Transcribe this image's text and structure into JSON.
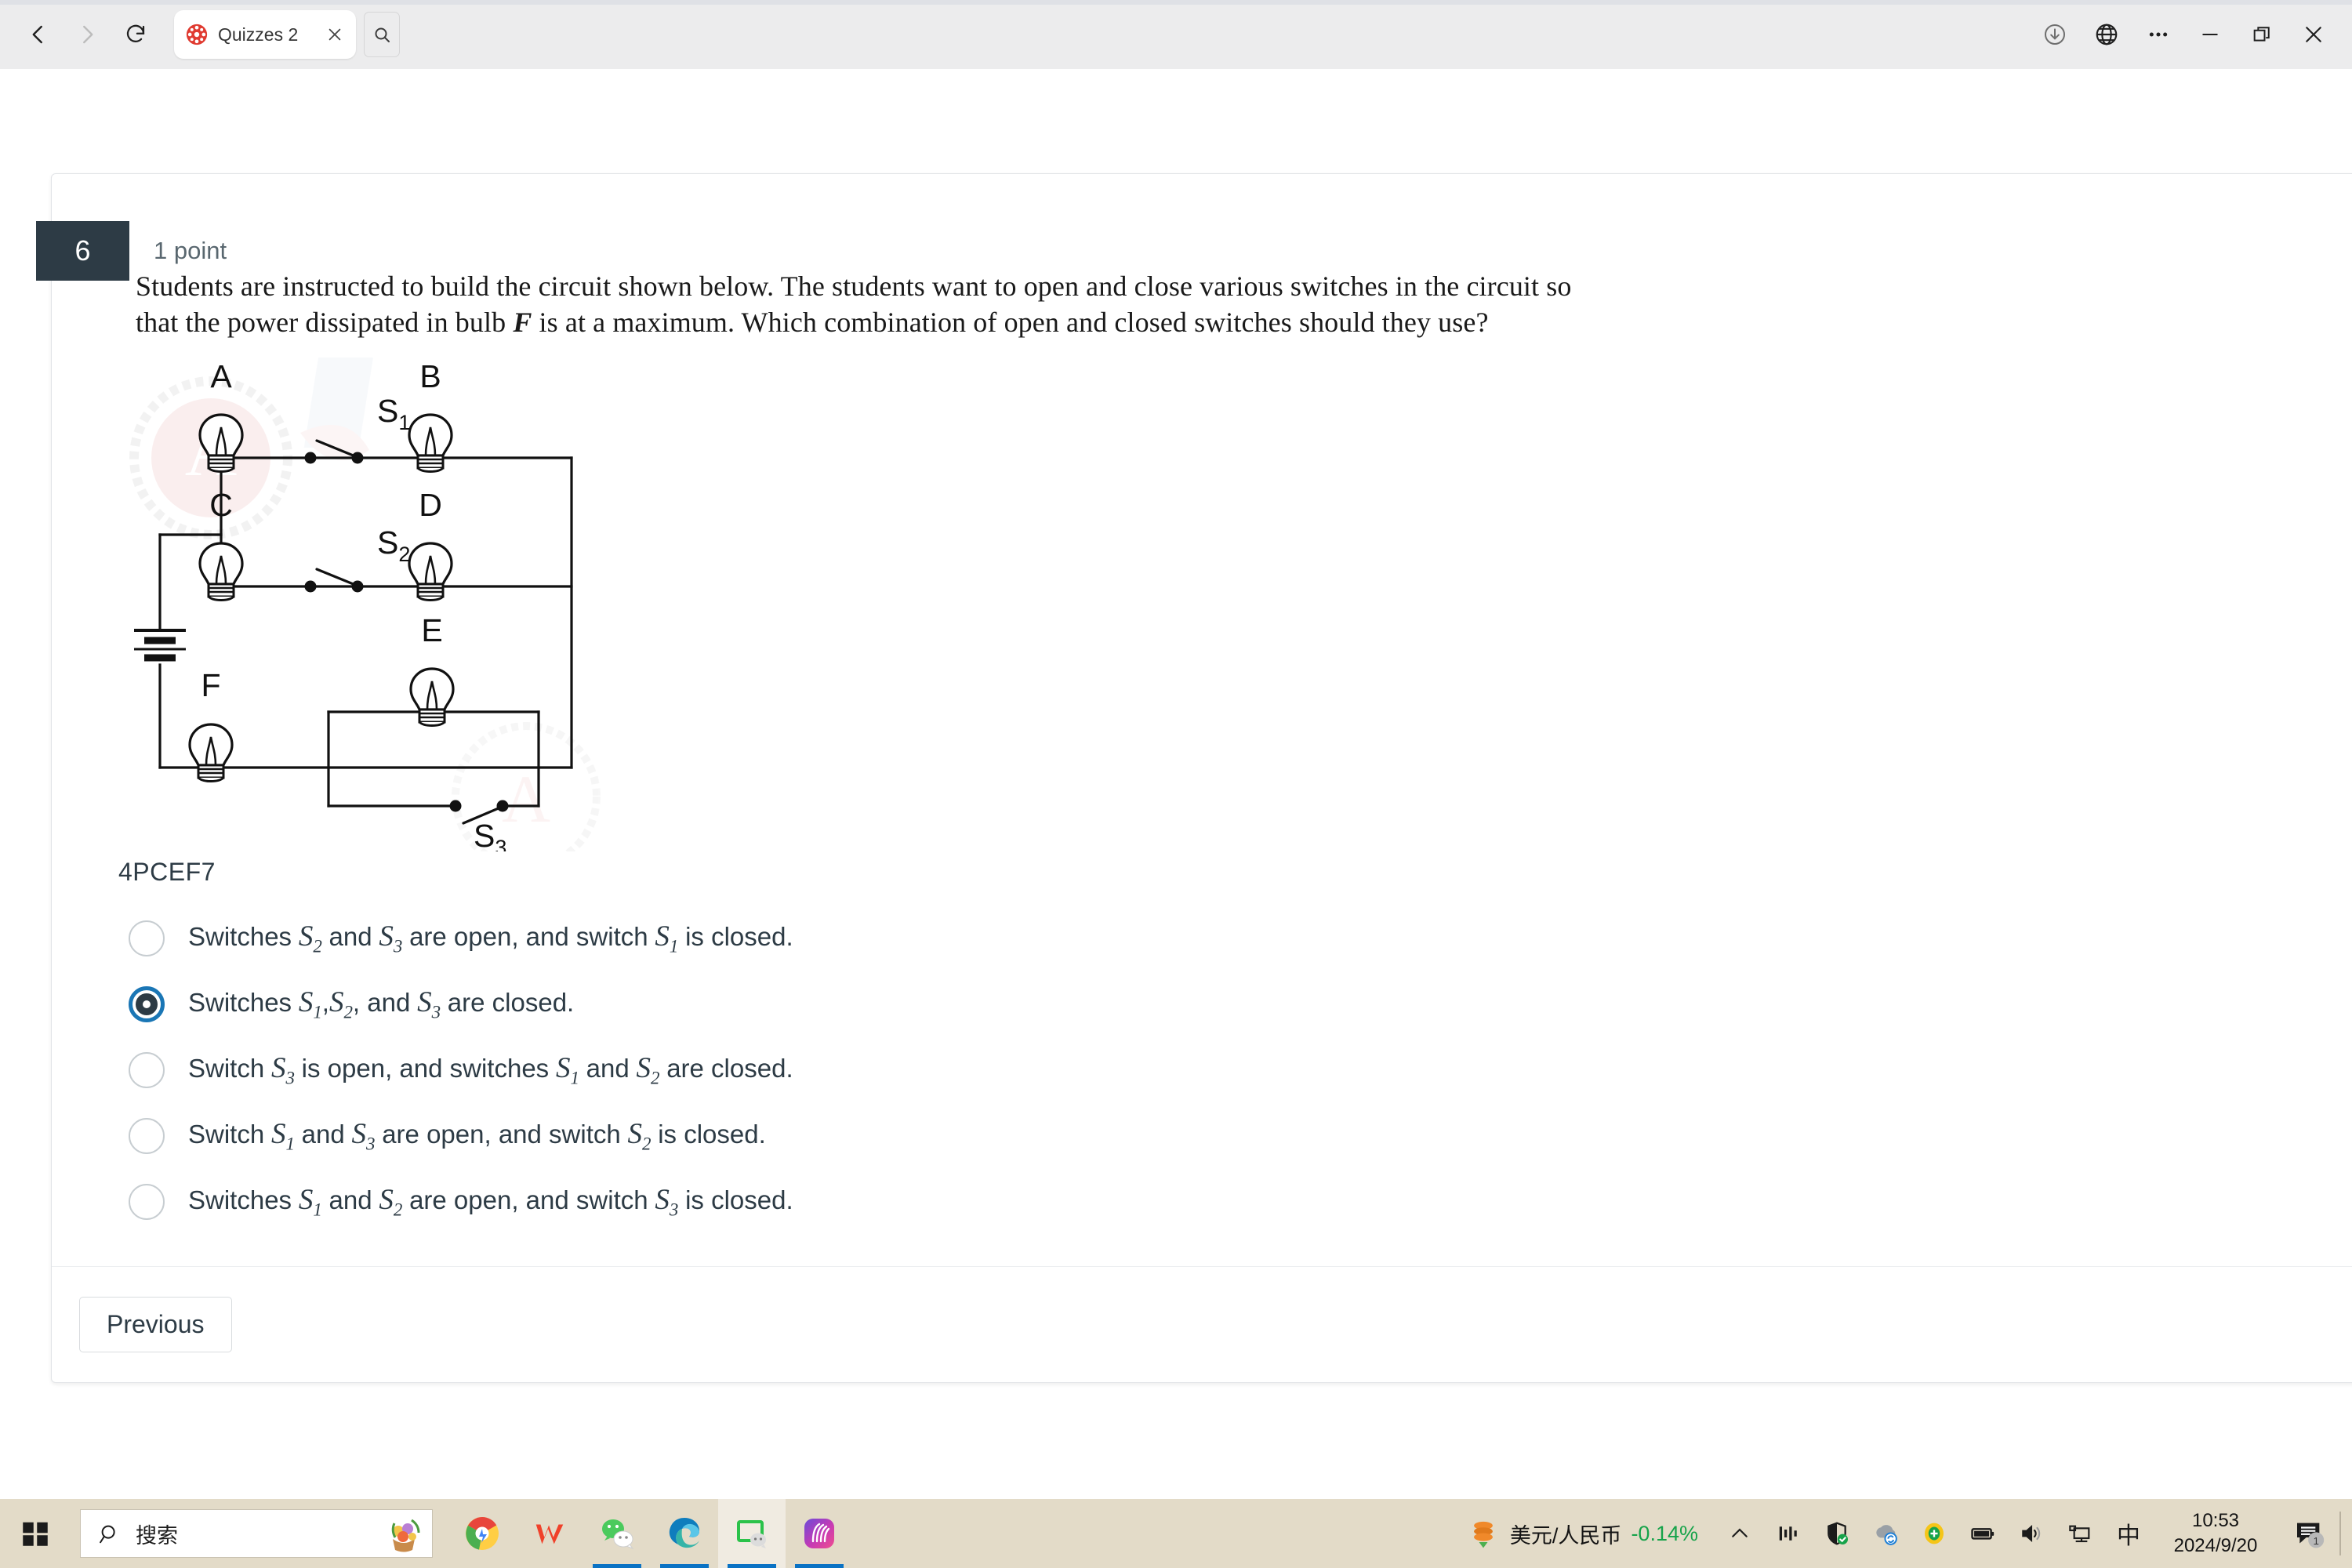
{
  "browser": {
    "back_icon": "back-arrow-icon",
    "forward_icon": "forward-arrow-icon",
    "reload_icon": "reload-icon",
    "tab": {
      "title": "Quizzes 2",
      "favicon": "canvas-lms-icon",
      "close_icon": "close-icon"
    },
    "tab_search_icon": "search-icon",
    "right_icons": [
      "downloads-icon",
      "globe-icon",
      "more-options-icon",
      "minimize-icon",
      "restore-icon",
      "window-close-icon"
    ]
  },
  "quiz": {
    "question_number": "6",
    "points": "1 point",
    "question_text_part1": "Students are instructed to build the circuit shown below. The students want to open and close various switches in the circuit so that the power dissipated in bulb ",
    "question_bulb_var": "F",
    "question_text_part2": " is at a maximum. Which combination of open and closed switches should they use?",
    "question_code": "4PCEF7",
    "previous_label": "Previous"
  },
  "circuit": {
    "bulbs": [
      "A",
      "B",
      "C",
      "D",
      "E",
      "F"
    ],
    "switches": [
      "S",
      "S",
      "S"
    ],
    "switch_subscripts": [
      "1",
      "2",
      "3"
    ],
    "battery": "battery-symbol",
    "watermark": "ASAA"
  },
  "answers": [
    {
      "selected": false,
      "lead": "Switches",
      "s_a": "S",
      "s_a_sub": "2",
      "mid1": "and",
      "s_b": "S",
      "s_b_sub": "3",
      "mid2": "are open, and switch",
      "s_c": "S",
      "s_c_sub": "1",
      "tail": "is closed."
    },
    {
      "selected": true,
      "lead": "Switches",
      "s_a": "S",
      "s_a_sub": "1",
      "mid1": ",",
      "s_b": "S",
      "s_b_sub": "2",
      "mid2": ", and",
      "s_c": "S",
      "s_c_sub": "3",
      "tail": "are closed."
    },
    {
      "selected": false,
      "lead": "Switch",
      "s_a": "S",
      "s_a_sub": "3",
      "mid1": "is open, and switches",
      "s_b": "S",
      "s_b_sub": "1",
      "mid2": "and",
      "s_c": "S",
      "s_c_sub": "2",
      "tail": "are closed."
    },
    {
      "selected": false,
      "lead": "Switch",
      "s_a": "S",
      "s_a_sub": "1",
      "mid1": "and",
      "s_b": "S",
      "s_b_sub": "3",
      "mid2": "are open, and switch",
      "s_c": "S",
      "s_c_sub": "2",
      "tail": "is closed."
    },
    {
      "selected": false,
      "lead": "Switches",
      "s_a": "S",
      "s_a_sub": "1",
      "mid1": "and",
      "s_b": "S",
      "s_b_sub": "2",
      "mid2": "are open, and switch",
      "s_c": "S",
      "s_c_sub": "3",
      "tail": "is closed."
    }
  ],
  "taskbar": {
    "start_icon": "windows-start-icon",
    "search_placeholder": "搜索",
    "search_icon": "search-icon",
    "apps": [
      {
        "name": "chrome-icon",
        "active": false,
        "running": false
      },
      {
        "name": "wps-office-icon",
        "active": false,
        "running": false
      },
      {
        "name": "wechat-icon",
        "active": false,
        "running": true
      },
      {
        "name": "microsoft-edge-icon",
        "active": false,
        "running": true
      },
      {
        "name": "wechat-devtools-icon",
        "active": true,
        "running": true
      },
      {
        "name": "meitu-icon",
        "active": false,
        "running": true
      }
    ],
    "stock_label": "美元/人民币",
    "stock_change": "-0.14%",
    "stock_color": "#16a34a",
    "tray_icons": [
      "show-hidden-icons-chevron",
      "netease-music-icon",
      "windows-security-icon",
      "backup-sync-icon",
      "360-security-icon",
      "battery-icon",
      "volume-icon",
      "network-icon",
      "ime-chinese-icon"
    ],
    "ime_label": "中",
    "time": "10:53",
    "date": "2024/9/20",
    "notification_count": "1",
    "notification_icon": "notifications-icon"
  },
  "colors": {
    "badge_bg": "#2d3b45",
    "accent_blue": "#1a76b5",
    "taskbar_bg": "#e3dbc8",
    "chrome_bg": "#ececed"
  }
}
